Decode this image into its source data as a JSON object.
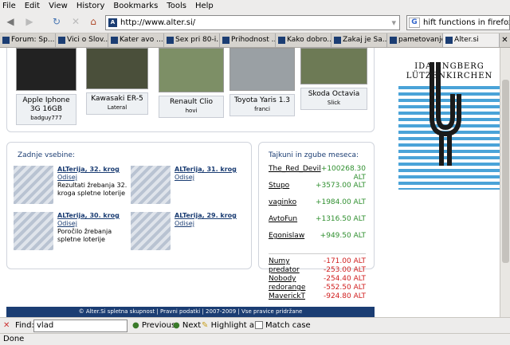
{
  "menu": [
    "File",
    "Edit",
    "View",
    "History",
    "Bookmarks",
    "Tools",
    "Help"
  ],
  "nav": {
    "back": "◀",
    "forward": "▶",
    "reload": "↻",
    "stop": "✕",
    "home": "⌂",
    "url": "http://www.alter.si/",
    "site_icon": "A",
    "search_engine": "G",
    "search_text": "hift functions in firefox"
  },
  "tabs": [
    "Forum: Sp...",
    "Vici o Slov...",
    "Kater avo ...",
    "Sex pri 80-i...",
    "Prihodnost ...",
    "Kako dobro...",
    "Zakaj je Sa...",
    "pametovanje",
    "Alter.si"
  ],
  "cars": [
    {
      "name": "Apple Iphone 3G 16GB",
      "user": "badguy777"
    },
    {
      "name": "Kawasaki ER-5",
      "user": "Lateral"
    },
    {
      "name": "Renault Clio",
      "user": "hovi"
    },
    {
      "name": "Toyota Yaris 1.3",
      "user": "franci"
    },
    {
      "name": "Skoda Octavia",
      "user": "Slick"
    }
  ],
  "latest": {
    "heading": "Zadnje vsebine:",
    "items": [
      {
        "title": "ALTerija, 32. krog",
        "author": "Odisej",
        "desc": "Rezultati žrebanja 32. kroga spletne loterije"
      },
      {
        "title": "ALTerija, 31. krog",
        "author": "Odisej",
        "desc": ""
      },
      {
        "title": "ALTerija, 30. krog",
        "author": "Odisej",
        "desc": "Poročilo žrebanja spletne loterije"
      },
      {
        "title": "ALTerija, 29. krog",
        "author": "Odisej",
        "desc": ""
      }
    ]
  },
  "gains": {
    "heading": "Tajkuni in zgube meseca:",
    "winners": [
      {
        "name": "The_Red_Devil",
        "value": "+100268.30 ALT"
      },
      {
        "name": "Stupo",
        "value": "+3573.00 ALT"
      },
      {
        "name": "vaginko",
        "value": "+1984.00 ALT"
      },
      {
        "name": "AvtoFun",
        "value": "+1316.50 ALT"
      },
      {
        "name": "Egonislaw",
        "value": "+949.50 ALT"
      }
    ],
    "losers": [
      {
        "name": "Numy",
        "value": "-171.00 ALT"
      },
      {
        "name": "predator",
        "value": "-253.00 ALT"
      },
      {
        "name": "Nobody",
        "value": "-254.40 ALT"
      },
      {
        "name": "redorange",
        "value": "-552.50 ALT"
      },
      {
        "name": "MaverickT",
        "value": "-924.80 ALT"
      }
    ]
  },
  "ad": {
    "line1": "IDA ENGBERG",
    "line2": "LÜTZENKIRCHEN"
  },
  "footer": "© Alter.Si spletna skupnost | Pravni podatki | 2007-2009 | Vse pravice pridržane",
  "find": {
    "label": "Find:",
    "value": "vlad",
    "previous": "Previous",
    "next": "Next",
    "highlight": "Highlight all",
    "match_case": "Match case"
  },
  "status": "Done",
  "colors": {
    "brand": "#1b3d73",
    "gain": "#2f8f2f",
    "loss": "#d01d1d"
  }
}
